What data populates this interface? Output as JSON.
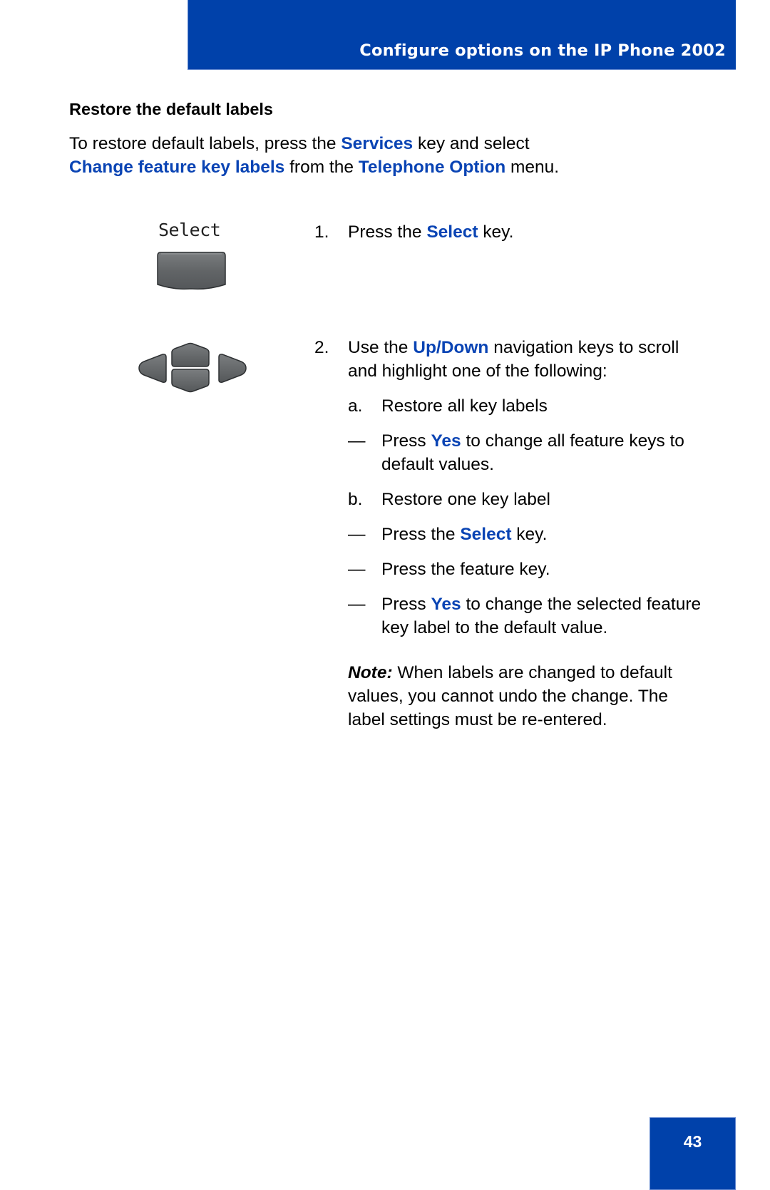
{
  "header": {
    "title": "Configure options on the IP Phone 2002"
  },
  "section": {
    "heading": "Restore the default labels",
    "intro": {
      "part1": "To restore default labels, press the ",
      "services": "Services",
      "part2": " key and select",
      "change_labels": "Change feature key labels",
      "part3": " from the ",
      "telephone_option": "Telephone Option",
      "part4": " menu."
    }
  },
  "figures": {
    "select_lcd_label": "Select",
    "select_key_icon": "softkey-button",
    "nav_keys_icon": "navigation-cluster"
  },
  "steps": [
    {
      "num": "1.",
      "pre": "Press the ",
      "key": "Select",
      "post": " key."
    },
    {
      "num": "2.",
      "pre": "Use the ",
      "key": "Up/Down",
      "post": " navigation keys to scroll and highlight one of the following:"
    }
  ],
  "substeps": [
    {
      "mark": "a.",
      "text": "Restore all key labels"
    },
    {
      "mark": "—",
      "pre": "Press ",
      "key": "Yes",
      "post": " to change all feature keys to default values."
    },
    {
      "mark": "b.",
      "text": "Restore one key label"
    },
    {
      "mark": "—",
      "pre": "Press the ",
      "key": "Select",
      "post": " key."
    },
    {
      "mark": "—",
      "text": "Press the feature key."
    },
    {
      "mark": "—",
      "pre": "Press ",
      "key": "Yes",
      "post": " to change the selected feature key label to the default value."
    }
  ],
  "note": {
    "label": "Note:",
    "text": " When labels are changed to default values, you cannot undo the change. The label settings must be re-entered."
  },
  "footer": {
    "page_number": "43"
  },
  "colors": {
    "brand_blue": "#0041aa",
    "highlight_blue": "#0a44b4"
  }
}
